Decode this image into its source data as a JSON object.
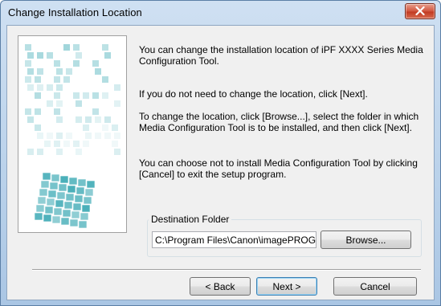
{
  "window": {
    "title": "Change Installation Location",
    "close_icon": "close-icon"
  },
  "content": {
    "paragraph1": "You can change the installation location of iPF XXXX  Series Media Configuration Tool.",
    "paragraph2": "If you do not need to change the location, click [Next].",
    "paragraph3": "To change the location, click [Browse...], select the folder in which Media Configuration Tool is to be installed, and then click [Next].",
    "paragraph4": "You can choose not to install Media Configuration Tool by clicking [Cancel] to exit the setup program."
  },
  "destination": {
    "group_label": "Destination Folder",
    "path_value": "C:\\Program Files\\Canon\\imagePROGRAF",
    "browse_label": "Browse..."
  },
  "buttons": {
    "back_label": "< Back",
    "next_label": "Next >",
    "cancel_label": "Cancel"
  },
  "colors": {
    "accent_cube": "#3aa9b4",
    "close_button": "#c13a22"
  }
}
